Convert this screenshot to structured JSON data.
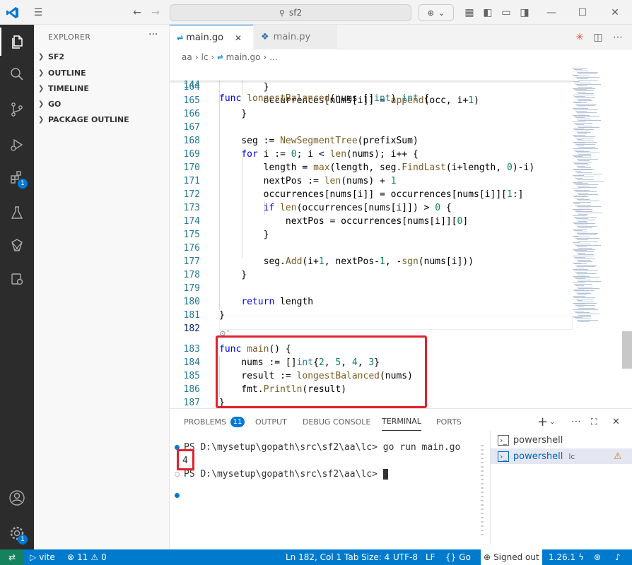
{
  "titlebar": {
    "search_text": "sf2"
  },
  "activity": {
    "extensions_badge": "1",
    "accounts_badge": "1"
  },
  "sidebar": {
    "title": "EXPLORER",
    "more": "···",
    "sections": [
      "SF2",
      "OUTLINE",
      "TIMELINE",
      "GO",
      "PACKAGE OUTLINE"
    ]
  },
  "tabs": [
    {
      "label": "main.go",
      "close": "✕"
    },
    {
      "label": "main.py"
    }
  ],
  "breadcrumb": {
    "p1": "aa",
    "p2": "lc",
    "file": "main.go",
    "more": "..."
  },
  "editor": {
    "sticky": {
      "ln": "144",
      "code": "func longestBalanced(nums []int) int {"
    },
    "lines": [
      {
        "ln": "164",
        "code": "        }"
      },
      {
        "ln": "165",
        "code": "        occurrences[nums[i]] = append(occ, i+1)"
      },
      {
        "ln": "166",
        "code": "    }"
      },
      {
        "ln": "167",
        "code": ""
      },
      {
        "ln": "168",
        "code": "    seg := NewSegmentTree(prefixSum)"
      },
      {
        "ln": "169",
        "code": "    for i := 0; i < len(nums); i++ {"
      },
      {
        "ln": "170",
        "code": "        length = max(length, seg.FindLast(i+length, 0)-i)"
      },
      {
        "ln": "171",
        "code": "        nextPos := len(nums) + 1"
      },
      {
        "ln": "172",
        "code": "        occurrences[nums[i]] = occurrences[nums[i]][1:]"
      },
      {
        "ln": "173",
        "code": "        if len(occurrences[nums[i]]) > 0 {"
      },
      {
        "ln": "174",
        "code": "            nextPos = occurrences[nums[i]][0]"
      },
      {
        "ln": "175",
        "code": "        }"
      },
      {
        "ln": "176",
        "code": ""
      },
      {
        "ln": "177",
        "code": "        seg.Add(i+1, nextPos-1, -sgn(nums[i]))"
      },
      {
        "ln": "178",
        "code": "    }"
      },
      {
        "ln": "179",
        "code": ""
      },
      {
        "ln": "180",
        "code": "    return length"
      },
      {
        "ln": "181",
        "code": "}"
      },
      {
        "ln": "182",
        "code": ""
      },
      {
        "ln": "183",
        "code": "func main() {"
      },
      {
        "ln": "184",
        "code": "    nums := []int{2, 5, 4, 3}"
      },
      {
        "ln": "185",
        "code": "    result := longestBalanced(nums)"
      },
      {
        "ln": "186",
        "code": "    fmt.Println(result)"
      },
      {
        "ln": "187",
        "code": "}"
      }
    ]
  },
  "panel": {
    "tabs": [
      "PROBLEMS",
      "OUTPUT",
      "DEBUG CONSOLE",
      "TERMINAL",
      "PORTS"
    ],
    "problems_count": "11",
    "active": "TERMINAL",
    "add": "+"
  },
  "terminal": {
    "line1": "PS D:\\mysetup\\gopath\\src\\sf2\\aa\\lc> go run main.go",
    "line2": "4",
    "line3": "PS D:\\mysetup\\gopath\\src\\sf2\\aa\\lc> ",
    "instances": [
      {
        "label": "powershell",
        "suffix": ""
      },
      {
        "label": "powershell",
        "suffix": "lc"
      }
    ]
  },
  "status": {
    "vite": "vite",
    "errors": "11",
    "warnings": "0",
    "position": "Ln 182, Col 1",
    "tabsize": "Tab Size: 4",
    "encoding": "UTF-8",
    "eol": "LF",
    "lang": "Go",
    "signed_out": "Signed out",
    "go_version": "1.26.1"
  }
}
